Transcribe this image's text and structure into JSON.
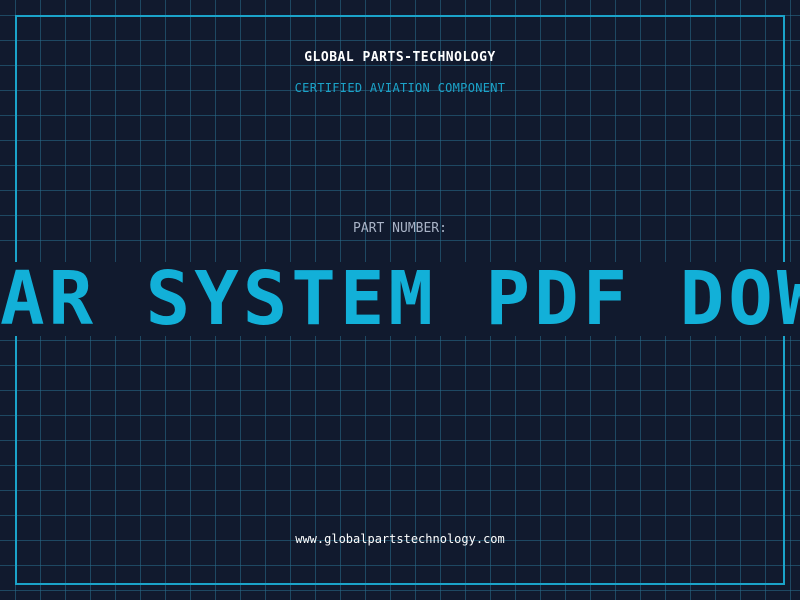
{
  "header": {
    "brand": "GLOBAL PARTS-TECHNOLOGY",
    "subtitle": "CERTIFIED AVIATION COMPONENT"
  },
  "part": {
    "label": "PART NUMBER:",
    "value": "AR SYSTEM PDF DOWNL"
  },
  "footer": {
    "url": "www.globalpartstechnology.com"
  },
  "colors": {
    "background": "#111a2e",
    "accent": "#1ba3c9",
    "part_number": "#12b0d8",
    "grid": "#286e8c"
  }
}
